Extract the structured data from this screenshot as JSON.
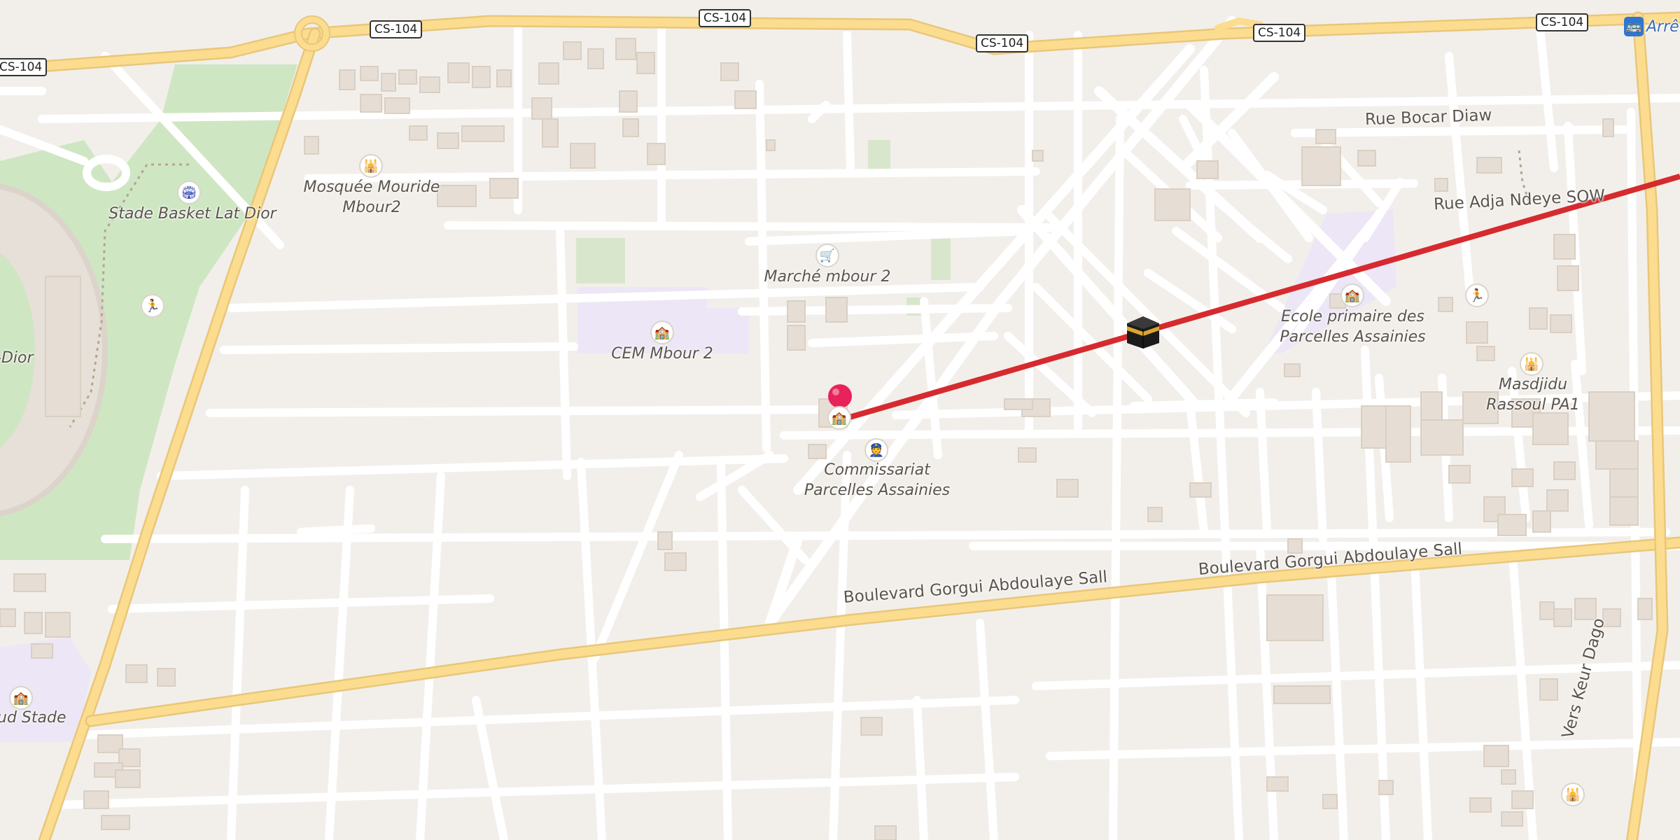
{
  "map": {
    "road_shields": [
      "CS-104",
      "CS-104",
      "CS-104",
      "CS-104",
      "CS-104",
      "CS-104"
    ],
    "labels": {
      "mosque_mouride": "Mosquée Mouride\nMbour2",
      "stade_basket": "Stade Basket Lat Dior",
      "marche": "Marché mbour 2",
      "cem": "CEM Mbour 2",
      "commissariat": "Commissariat\nParcelles Assainies",
      "ecole": "Ecole primaire des\nParcelles Assainies",
      "masdjidu": "Masdjidu\nRassoul PA1",
      "dior_partial": "-Dior",
      "stade_partial": "ud Stade",
      "arret_partial": "Arrê"
    },
    "street_names": {
      "rue_bocar": "Rue Bocar Diaw",
      "rue_adja": "Rue Adja Ndeye SOW",
      "boulevard_1": "Boulevard Gorgui Abdoulaye Sall",
      "boulevard_2": "Boulevard Gorgui Abdoulaye Sall",
      "vers_keur": "Vers Keur Dago"
    },
    "icons": {
      "mosque": "mosque-icon",
      "school": "school-icon",
      "market": "shopping-cart-icon",
      "police": "police-icon",
      "sports": "sports-icon",
      "kaaba": "kaaba-icon",
      "pin": "location-pin-icon",
      "bus": "bus-stop-icon"
    },
    "colors": {
      "background": "#f2efeb",
      "main_road": "#fcdc8e",
      "minor_road": "#ffffff",
      "park": "#cfe6c3",
      "school_area": "#ece6f6",
      "qibla_line": "#d62a2e",
      "pin": "#e8225a"
    }
  }
}
